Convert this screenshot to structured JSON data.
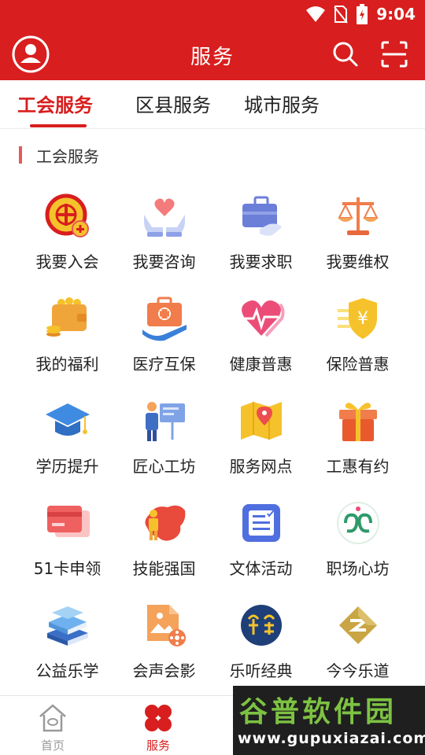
{
  "status_bar": {
    "time": "9:04",
    "icons": [
      "wifi-icon",
      "no-sim-icon",
      "battery-charging-icon"
    ]
  },
  "app_bar": {
    "title": "服务",
    "icons": [
      "user-avatar-icon",
      "search-icon",
      "scan-icon"
    ]
  },
  "tabs": [
    {
      "label": "工会服务",
      "active": true
    },
    {
      "label": "区县服务",
      "active": false
    },
    {
      "label": "城市服务",
      "active": false
    }
  ],
  "section": {
    "title": "工会服务"
  },
  "services": [
    {
      "label": "我要入会",
      "icon": "union-emblem-icon"
    },
    {
      "label": "我要咨询",
      "icon": "hands-heart-icon"
    },
    {
      "label": "我要求职",
      "icon": "briefcase-icon"
    },
    {
      "label": "我要维权",
      "icon": "scales-icon"
    },
    {
      "label": "我的福利",
      "icon": "wallet-coins-icon"
    },
    {
      "label": "医疗互保",
      "icon": "medical-kit-icon"
    },
    {
      "label": "健康普惠",
      "icon": "heart-pulse-icon"
    },
    {
      "label": "保险普惠",
      "icon": "shield-yuan-icon"
    },
    {
      "label": "学历提升",
      "icon": "graduation-cap-icon"
    },
    {
      "label": "匠心工坊",
      "icon": "teacher-board-icon"
    },
    {
      "label": "服务网点",
      "icon": "map-pin-icon"
    },
    {
      "label": "工惠有约",
      "icon": "gift-box-icon"
    },
    {
      "label": "51卡申领",
      "icon": "bank-card-icon"
    },
    {
      "label": "技能强国",
      "icon": "china-map-worker-icon"
    },
    {
      "label": "文体活动",
      "icon": "calendar-list-icon"
    },
    {
      "label": "职场心坊",
      "icon": "heart-logo-icon"
    },
    {
      "label": "公益乐学",
      "icon": "books-stack-icon"
    },
    {
      "label": "会声会影",
      "icon": "film-reel-icon"
    },
    {
      "label": "乐听经典",
      "icon": "listen-classic-icon"
    },
    {
      "label": "今今乐道",
      "icon": "gold-logo-icon"
    }
  ],
  "bottom_nav": [
    {
      "label": "首页",
      "icon": "home-icon",
      "active": false
    },
    {
      "label": "服务",
      "icon": "clover-icon",
      "active": true
    }
  ],
  "watermark": {
    "title": "谷普软件园",
    "url": "www.gupuxiazai.com"
  },
  "colors": {
    "brand_red": "#d81e1e",
    "text": "#222222",
    "muted": "#999999"
  }
}
